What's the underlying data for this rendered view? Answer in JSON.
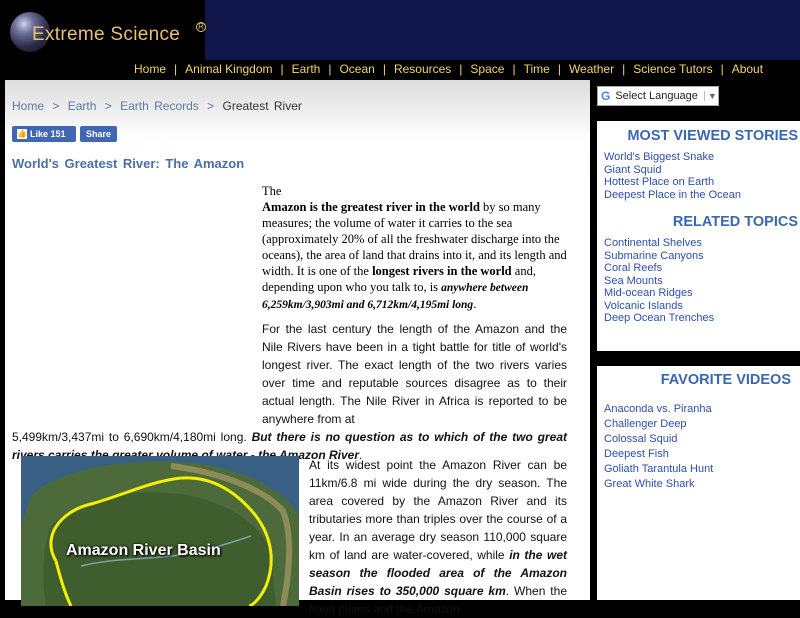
{
  "header": {
    "logo_text": "Extreme Science",
    "registered_mark": "R"
  },
  "nav": {
    "items": [
      "Home",
      "Animal Kingdom",
      "Earth",
      "Ocean",
      "Resources",
      "Space",
      "Time",
      "Weather",
      "Science Tutors",
      "About"
    ],
    "separator": "|"
  },
  "breadcrumb": {
    "items": [
      "Home",
      "Earth",
      "Earth Records"
    ],
    "current": "Greatest River",
    "separator": ">"
  },
  "facebook": {
    "like_label": "Like",
    "like_count": "151",
    "share_label": "Share"
  },
  "page_title": "World's Greatest River: The Amazon",
  "para1": {
    "t1": "The",
    "b1": "Amazon is the greatest river in the world",
    "t2": " by so many measures; the volume of water it carries to the sea (approximately 20% of all the freshwater discharge into the oceans), the area of land that drains into it, and its length and width. It is one of the ",
    "b2": "longest rivers in the world",
    "t3": " and, depending upon who you talk to, is ",
    "b3": "anywhere between 6,259km/3,903mi and 6,712km/4,195mi long",
    "t4": "."
  },
  "para2": {
    "t1": "For the last century the length of the Amazon and the Nile Rivers have been in a tight battle for title of world's longest river. The exact length of the two rivers varies over time and reputable sources disagree as to their actual length. The Nile River in Africa is reported to be anywhere from at",
    "t2": "5,499km/3,437mi to 6,690km/4,180mi long. ",
    "b1": "But there is no question as to which of the two great rivers carries the greater volume of water - the Amazon River",
    "t3": "."
  },
  "map_image": {
    "label": "Amazon River Basin"
  },
  "para3": {
    "t1": "At its widest point the Amazon River can be 11km/6.8 mi wide during the dry season. The area covered by the Amazon River and its tributaries more than triples over the course of a year. In an average dry season 110,000 square km of land are water-covered, while ",
    "b1": "in the wet season the flooded area of the Amazon Basin rises to 350,000 square km",
    "t2": ". When the flood plains and the Amazon"
  },
  "sidebar": {
    "language": {
      "g_icon": "G",
      "label": "Select Language",
      "caret": "▼"
    },
    "most_viewed": {
      "title": "MOST VIEWED STORIES",
      "items": [
        "World's Biggest Snake",
        "Giant Squid",
        "Hottest Place on Earth",
        "Deepest Place in the Ocean"
      ]
    },
    "related": {
      "title": "RELATED TOPICS",
      "items": [
        "Continental Shelves",
        "Submarine Canyons",
        "Coral Reefs",
        "Sea Mounts",
        "Mid-ocean Ridges",
        "Volcanic Islands",
        "Deep Ocean Trenches"
      ]
    },
    "favorite_videos": {
      "title": "FAVORITE VIDEOS",
      "items": [
        "Anaconda vs. Piranha",
        "Challenger Deep",
        "Colossal Squid",
        "Deepest Fish",
        "Goliath Tarantula Hunt",
        "Great White Shark"
      ]
    }
  }
}
